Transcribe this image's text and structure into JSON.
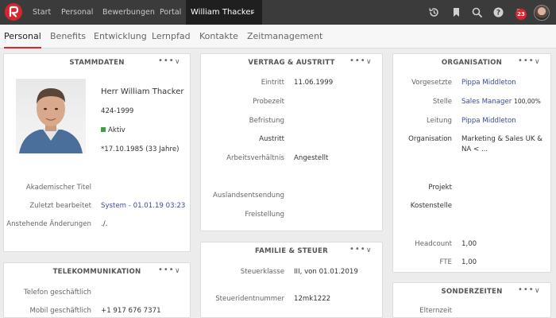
{
  "topbar": {
    "nav": [
      "Start",
      "Personal",
      "Bewerbungen",
      "Portal"
    ],
    "active": "William Thacker",
    "notification_count": "23"
  },
  "tabs": [
    "Personal",
    "Benefits",
    "Entwicklung",
    "Lernpfad",
    "Kontakte",
    "Zeitmanagement"
  ],
  "stammdaten": {
    "title": "STAMMDATEN",
    "name": "Herr William Thacker",
    "id": "424-1999",
    "status": "Aktiv",
    "birth": "*17.10.1985 (33 Jahre)",
    "rows": [
      {
        "label": "Akademischer Titel",
        "value": ""
      },
      {
        "label": "Zuletzt bearbeitet",
        "value": "System - 01.01.19 03:23"
      },
      {
        "label": "Anstehende Änderungen",
        "value": "./."
      }
    ]
  },
  "telekom": {
    "title": "TELEKOMMUNIKATION",
    "rows": [
      {
        "label": "Telefon geschäftlich",
        "value": ""
      },
      {
        "label": "Mobil geschäftlich",
        "value": "+1 917 676 7371"
      }
    ]
  },
  "vertrag": {
    "title": "VERTRAG & AUSTRITT",
    "rows": [
      {
        "label": "Eintritt",
        "value": "11.06.1999"
      },
      {
        "label": "Probezeit",
        "value": ""
      },
      {
        "label": "Befristung",
        "value": ""
      },
      {
        "label": "Austritt",
        "value": ""
      },
      {
        "label": "Arbeitsverhältnis",
        "value": "Angestellt"
      },
      {
        "label": "Auslandsentsendung",
        "value": ""
      },
      {
        "label": "Freistellung",
        "value": ""
      }
    ]
  },
  "familie": {
    "title": "FAMILIE & STEUER",
    "rows": [
      {
        "label": "Steuerklasse",
        "value": "III, von 01.01.2019"
      },
      {
        "label": "Steueridentnummer",
        "value": "12mk1222"
      }
    ]
  },
  "organisation": {
    "title": "ORGANISATION",
    "vorgesetzte_label": "Vorgesetzte",
    "vorgesetzte_value": "Pippa Middleton",
    "stelle_label": "Stelle",
    "stelle_value": "Sales Manager",
    "stelle_pct": "100,00%",
    "leitung_label": "Leitung",
    "leitung_value": "Pippa Middleton",
    "org_label": "Organisation",
    "org_line1": "Marketing & Sales UK &",
    "org_line2": "NA < ...",
    "projekt_label": "Projekt",
    "kostenstelle_label": "Kostenstelle",
    "headcount_label": "Headcount",
    "headcount_value": "1,00",
    "fte_label": "FTE",
    "fte_value": "1,00"
  },
  "sonderzeiten": {
    "title": "SONDERZEITEN",
    "row_label": "Elternzeit"
  },
  "icons": [
    "history-icon",
    "bookmark-icon",
    "search-icon",
    "help-icon",
    "bell-icon"
  ]
}
